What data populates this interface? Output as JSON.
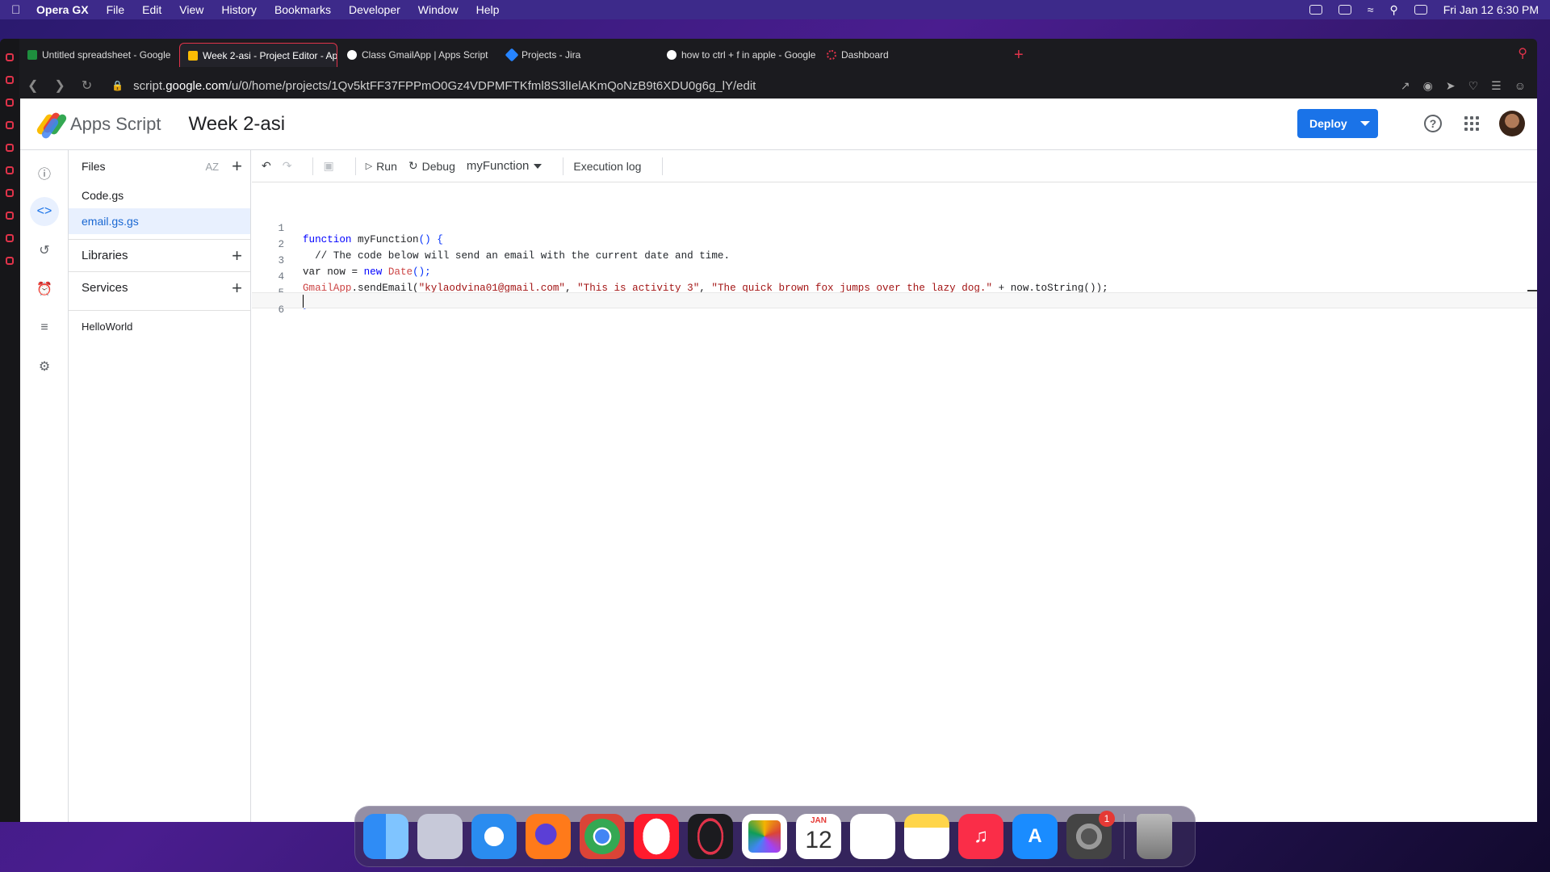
{
  "menubar": {
    "app": "Opera GX",
    "items": [
      "File",
      "Edit",
      "View",
      "History",
      "Bookmarks",
      "Developer",
      "Window",
      "Help"
    ],
    "datetime": "Fri Jan 12  6:30 PM"
  },
  "browser": {
    "tabs": [
      {
        "label": "Untitled spreadsheet - Google",
        "color": "#1e8e3e"
      },
      {
        "label": "Week 2-asi - Project Editor - Ap",
        "color": "#fbbc04"
      },
      {
        "label": "Class GmailApp  |  Apps Script",
        "color": "#ffffff"
      },
      {
        "label": "Projects - Jira",
        "color": "#2684ff"
      },
      {
        "label": "how to ctrl + f in apple - Google",
        "color": "#ffffff"
      },
      {
        "label": "Dashboard",
        "color": "#e0334a"
      }
    ],
    "url_prefix": "script.",
    "url_domain": "google.com",
    "url_path": "/u/0/home/projects/1Qv5ktFF37FPPmO0Gz4VDPMFTKfml8S3lIelAKmQoNzB9t6XDU0g6g_lY/edit"
  },
  "app": {
    "brand": "Apps Script",
    "project_title": "Week 2-asi",
    "deploy_label": "Deploy",
    "help_glyph": "?"
  },
  "files_panel": {
    "title": "Files",
    "sort_label": "AZ",
    "files": [
      "Code.gs",
      "email.gs.gs"
    ],
    "libraries_label": "Libraries",
    "services_label": "Services",
    "hello": "HelloWorld"
  },
  "toolbar": {
    "run_label": "Run",
    "debug_label": "Debug",
    "function_name": "myFunction",
    "execution_log_label": "Execution log"
  },
  "editor": {
    "line_numbers": [
      "1",
      "2",
      "3",
      "4",
      "5",
      "6"
    ],
    "l1_kw": "function",
    "l1_rest": " myFunction",
    "l1_punc": "() {",
    "l2": "  // The code below will send an email with the current date and time.",
    "l3_a": "var now = ",
    "l3_new": "new",
    "l3_date": " Date",
    "l3_end": "();",
    "l4_cls": "GmailApp",
    "l4_call": ".sendEmail(",
    "l4_s1": "\"kylaodvina01@gmail.com\"",
    "l4_c1": ", ",
    "l4_s2": "\"This is activity 3\"",
    "l4_c2": ", ",
    "l4_s3": "\"The quick brown fox jumps over the lazy dog.\"",
    "l4_end": " + now.toString());",
    "l5": "}"
  },
  "dock": {
    "calendar_month": "JAN",
    "calendar_day": "12",
    "settings_badge": "1"
  }
}
